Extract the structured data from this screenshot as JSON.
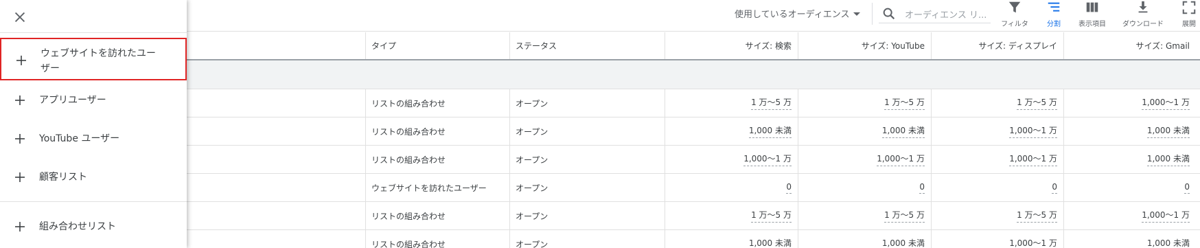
{
  "drawer": {
    "items": [
      {
        "label": "ウェブサイトを訪れたユー\nザー",
        "icon": "plus-icon"
      },
      {
        "label": "アプリユーザー",
        "icon": "plus-icon"
      },
      {
        "label": "YouTube ユーザー",
        "icon": "plus-icon"
      },
      {
        "label": "顧客リスト",
        "icon": "plus-icon"
      },
      {
        "label": "組み合わせリスト",
        "icon": "plus-icon"
      }
    ],
    "highlight_color": "#e02424"
  },
  "toolbar": {
    "audience_select": "使用しているオーディエンス",
    "search_placeholder": "オーディエンス リ...",
    "buttons": [
      {
        "label": "フィルタ",
        "icon": "filter-icon"
      },
      {
        "label": "分割",
        "icon": "segment-icon",
        "active": true
      },
      {
        "label": "表示項目",
        "icon": "columns-icon"
      },
      {
        "label": "ダウンロード",
        "icon": "download-icon"
      },
      {
        "label": "展開",
        "icon": "expand-icon"
      }
    ],
    "active_color": "#1a73e8"
  },
  "table": {
    "headers": [
      "タイプ",
      "ステータス",
      "サイズ: 検索",
      "サイズ: YouTube",
      "サイズ: ディスプレイ",
      "サイズ: Gmail"
    ],
    "rows": [
      [
        "リストの組み合わせ",
        "オープン",
        "1 万～5 万",
        "1 万～5 万",
        "1 万～5 万",
        "1,000～1 万"
      ],
      [
        "リストの組み合わせ",
        "オープン",
        "1,000 未満",
        "1,000 未満",
        "1,000～1 万",
        "1,000 未満"
      ],
      [
        "リストの組み合わせ",
        "オープン",
        "1,000～1 万",
        "1,000～1 万",
        "1,000～1 万",
        "1,000 未満"
      ],
      [
        "ウェブサイトを訪れたユーザー",
        "オープン",
        "0",
        "0",
        "0",
        "0"
      ],
      [
        "リストの組み合わせ",
        "オープン",
        "1 万～5 万",
        "1 万～5 万",
        "1 万～5 万",
        "1,000～1 万"
      ],
      [
        "リストの組み合わせ",
        "オープン",
        "1,000 未満",
        "1,000 未満",
        "1,000～1 万",
        "1,000 未満"
      ]
    ]
  }
}
